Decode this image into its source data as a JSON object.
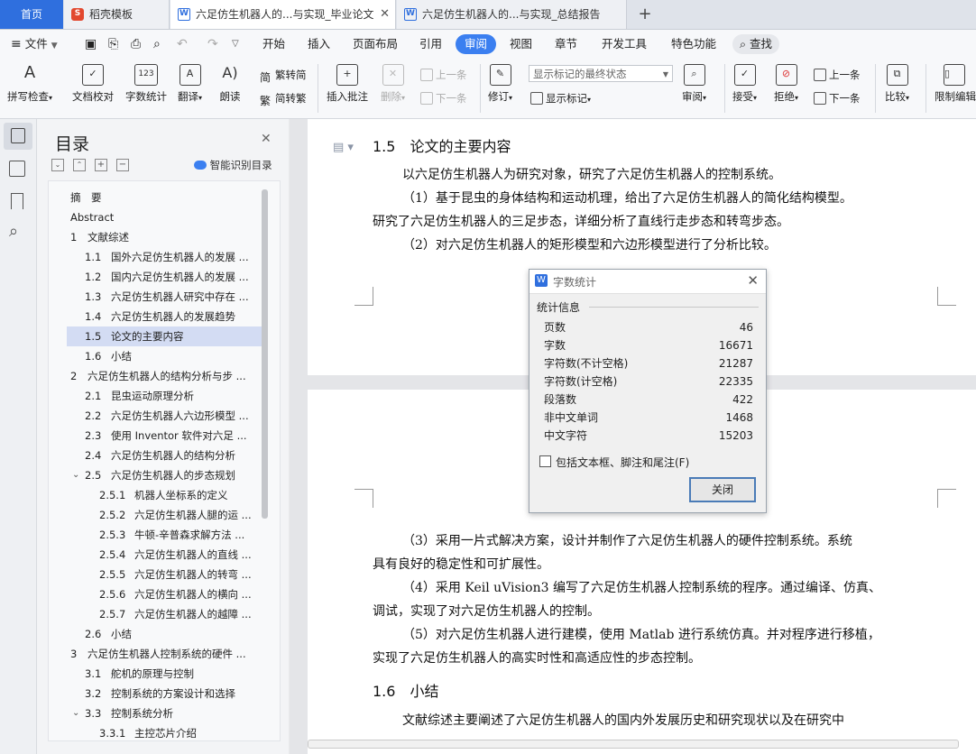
{
  "tabs": {
    "home": "首页",
    "template": "稻壳模板",
    "doc1": "六足仿生机器人的...与实现_毕业论文",
    "doc2": "六足仿生机器人的...与实现_总结报告",
    "new_tab": "+"
  },
  "menu": {
    "file": "文件",
    "items": [
      "开始",
      "插入",
      "页面布局",
      "引用",
      "审阅",
      "视图",
      "章节",
      "开发工具",
      "特色功能"
    ],
    "active": "审阅",
    "search": "查找"
  },
  "ribbon": {
    "spell": "拼写检查",
    "doc_check": "文档校对",
    "word_count": "字数统计",
    "translate": "翻译",
    "read_aloud": "朗读",
    "to_traditional": "繁转简",
    "to_simplified": "简转繁",
    "insert_comment": "插入批注",
    "delete": "删除",
    "prev_comment": "上一条",
    "next_comment": "下一条",
    "revise": "修订",
    "markup_state": "显示标记的最终状态",
    "show_markup": "显示标记",
    "review": "审阅",
    "accept": "接受",
    "reject": "拒绝",
    "prev": "上一条",
    "next": "下一条",
    "compare": "比较",
    "restrict": "限制编辑"
  },
  "toc": {
    "title": "目录",
    "smart": "智能识别目录",
    "items": [
      {
        "num": "",
        "text": "摘　要",
        "level": 1
      },
      {
        "num": "",
        "text": "Abstract",
        "level": 1
      },
      {
        "num": "1",
        "text": "文献综述",
        "level": 1,
        "chev": "v"
      },
      {
        "num": "1.1",
        "text": "国外六足仿生机器人的发展 ...",
        "level": 2
      },
      {
        "num": "1.2",
        "text": "国内六足仿生机器人的发展 ...",
        "level": 2
      },
      {
        "num": "1.3",
        "text": "六足仿生机器人研究中存在 ...",
        "level": 2
      },
      {
        "num": "1.4",
        "text": "六足仿生机器人的发展趋势",
        "level": 2
      },
      {
        "num": "1.5",
        "text": "论文的主要内容",
        "level": 2,
        "selected": true
      },
      {
        "num": "1.6",
        "text": "小结",
        "level": 2
      },
      {
        "num": "2",
        "text": "六足仿生机器人的结构分析与步 ...",
        "level": 1,
        "chev": "v"
      },
      {
        "num": "2.1",
        "text": "昆虫运动原理分析",
        "level": 2
      },
      {
        "num": "2.2",
        "text": "六足仿生机器人六边形模型 ...",
        "level": 2
      },
      {
        "num": "2.3",
        "text": "使用 Inventor 软件对六足 ...",
        "level": 2
      },
      {
        "num": "2.4",
        "text": "六足仿生机器人的结构分析",
        "level": 2
      },
      {
        "num": "2.5",
        "text": "六足仿生机器人的步态规划",
        "level": 2,
        "chev": "v"
      },
      {
        "num": "2.5.1",
        "text": "机器人坐标系的定义",
        "level": 3
      },
      {
        "num": "2.5.2",
        "text": "六足仿生机器人腿的运 ...",
        "level": 3
      },
      {
        "num": "2.5.3",
        "text": "牛顿-辛普森求解方法 ...",
        "level": 3
      },
      {
        "num": "2.5.4",
        "text": "六足仿生机器人的直线 ...",
        "level": 3
      },
      {
        "num": "2.5.5",
        "text": "六足仿生机器人的转弯 ...",
        "level": 3
      },
      {
        "num": "2.5.6",
        "text": "六足仿生机器人的横向 ...",
        "level": 3
      },
      {
        "num": "2.5.7",
        "text": "六足仿生机器人的越障 ...",
        "level": 3
      },
      {
        "num": "2.6",
        "text": "小结",
        "level": 2
      },
      {
        "num": "3",
        "text": "六足仿生机器人控制系统的硬件 ...",
        "level": 1,
        "chev": "v"
      },
      {
        "num": "3.1",
        "text": "舵机的原理与控制",
        "level": 2
      },
      {
        "num": "3.2",
        "text": "控制系统的方案设计和选择",
        "level": 2
      },
      {
        "num": "3.3",
        "text": "控制系统分析",
        "level": 2,
        "chev": "v"
      },
      {
        "num": "3.3.1",
        "text": "主控芯片介绍",
        "level": 3
      }
    ]
  },
  "doc": {
    "heading1": "1.5　论文的主要内容",
    "p1": "以六足仿生机器人为研究对象，研究了六足仿生机器人的控制系统。",
    "p2a": "（1）基于昆虫的身体结构和运动机理，给出了六足仿生机器人的简化结构模型。",
    "p2b": "研究了六足仿生机器人的三足步态，详细分析了直线行走步态和转弯步态。",
    "p3": "（2）对六足仿生机器人的矩形模型和六边形模型进行了分析比较。",
    "p4a": "（3）采用一片式解决方案，设计并制作了六足仿生机器人的硬件控制系统。系统",
    "p4b": "具有良好的稳定性和可扩展性。",
    "p5a": "（4）采用 Keil uVision3 编写了六足仿生机器人控制系统的程序。通过编译、仿真、",
    "p5b": "调试，实现了对六足仿生机器人的控制。",
    "p6a": "（5）对六足仿生机器人进行建模，使用 Matlab 进行系统仿真。并对程序进行移植，",
    "p6b": "实现了六足仿生机器人的高实时性和高适应性的步态控制。",
    "heading2": "1.6　小结",
    "p7": "文献综述主要阐述了六足仿生机器人的国内外发展历史和研究现状以及在研究中"
  },
  "dialog": {
    "title": "字数统计",
    "section": "统计信息",
    "rows": [
      {
        "label": "页数",
        "value": "46"
      },
      {
        "label": "字数",
        "value": "16671"
      },
      {
        "label": "字符数(不计空格)",
        "value": "21287"
      },
      {
        "label": "字符数(计空格)",
        "value": "22335"
      },
      {
        "label": "段落数",
        "value": "422"
      },
      {
        "label": "非中文单词",
        "value": "1468"
      },
      {
        "label": "中文字符",
        "value": "15203"
      }
    ],
    "checkbox": "包括文本框、脚注和尾注(F)",
    "close": "关闭"
  },
  "colors": {
    "accent": "#3b7ff0",
    "home_tab": "#2f6fde",
    "selection": "#d3dcf3"
  }
}
